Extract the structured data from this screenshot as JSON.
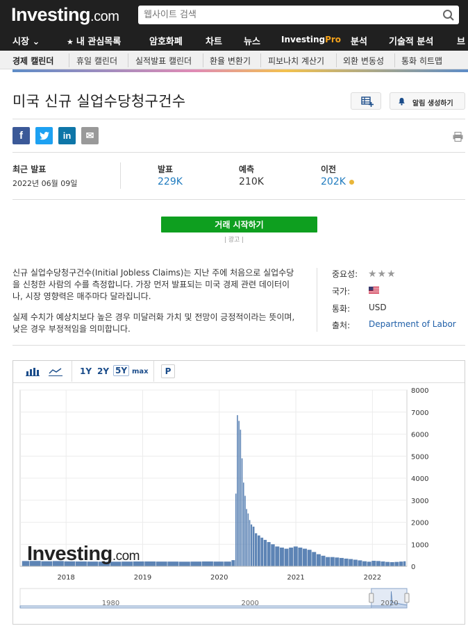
{
  "header": {
    "logo_main": "Investing",
    "logo_domain": ".com",
    "search_placeholder": "웹사이트 검색"
  },
  "nav": {
    "items": [
      {
        "label": "시장 ⌄"
      },
      {
        "label": "내 관심목록"
      },
      {
        "label": "암호화폐"
      },
      {
        "label": "차트"
      },
      {
        "label": "뉴스"
      },
      {
        "label": "Investing",
        "pro": "Pro"
      },
      {
        "label": "분석"
      },
      {
        "label": "기술적 분석"
      },
      {
        "label": "브"
      }
    ]
  },
  "subnav": {
    "items": [
      "경제 캘린더",
      "휴일 캘린더",
      "실적발표 캘린더",
      "환율 변환기",
      "피보나치 계산기",
      "외환 변동성",
      "통화 히트맵"
    ]
  },
  "page": {
    "title": "미국 신규 실업수당청구건수",
    "alert_button": "알림 생성하기"
  },
  "social": {
    "facebook": "f",
    "twitter": "t",
    "linkedin": "in",
    "email": "✉"
  },
  "release": {
    "latest_label": "최근 발표",
    "latest_date": "2022년 06월 09일",
    "actual_label": "발표",
    "actual_value": "229K",
    "forecast_label": "예측",
    "forecast_value": "210K",
    "previous_label": "이전",
    "previous_value": "202K",
    "previous_dot_color": "#e9b63a"
  },
  "trade": {
    "button": "거래 시작하기",
    "ad_label": "| 광고 |"
  },
  "description": {
    "p1": "신규 실업수당청구건수(Initial Jobless Claims)는 지난 주에 처음으로 실업수당을 신청한 사람의 수를 측정합니다. 가장 먼저 발표되는 미국 경제 관련 데이터이나, 시장 영향력은 매주마다 달라집니다.",
    "p2": "실제 수치가 예상치보다 높은 경우 미달러화 가치 및 전망이 긍정적이라는 뜻이며, 낮은 경우 부정적임을 의미합니다."
  },
  "details": {
    "importance_label": "중요성:",
    "importance_stars": 3,
    "country_label": "국가:",
    "country_flag": "us-flag-icon",
    "currency_label": "통화:",
    "currency_value": "USD",
    "source_label": "출처:",
    "source_value": "Department of Labor"
  },
  "chart_toolbar": {
    "ranges": [
      "1Y",
      "2Y",
      "5Y",
      "max"
    ],
    "selected_range": "5Y",
    "p_label": "P"
  },
  "chart_data": {
    "type": "bar",
    "bar_color": "#5d84b5",
    "ylim": [
      0,
      8000
    ],
    "yticks": [
      0,
      1000,
      2000,
      3000,
      4000,
      5000,
      6000,
      7000,
      8000
    ],
    "ytick_labels": [
      "0",
      "1000",
      "2000",
      "3000",
      "4000",
      "5000",
      "6000",
      "7000",
      "8000"
    ],
    "xticks": [
      2018,
      2019,
      2020,
      2021,
      2022
    ],
    "x_range": [
      2017.4,
      2022.45
    ],
    "series": [
      {
        "values_note_excluded": false,
        "points": [
          [
            2017.45,
            240
          ],
          [
            2017.6,
            245
          ],
          [
            2017.75,
            230
          ],
          [
            2017.9,
            240
          ],
          [
            2018.05,
            225
          ],
          [
            2018.2,
            220
          ],
          [
            2018.35,
            215
          ],
          [
            2018.5,
            210
          ],
          [
            2018.65,
            210
          ],
          [
            2018.8,
            215
          ],
          [
            2018.95,
            220
          ],
          [
            2019.1,
            220
          ],
          [
            2019.25,
            215
          ],
          [
            2019.4,
            215
          ],
          [
            2019.55,
            210
          ],
          [
            2019.7,
            215
          ],
          [
            2019.85,
            220
          ],
          [
            2020.0,
            215
          ],
          [
            2020.12,
            215
          ],
          [
            2020.2,
            280
          ],
          [
            2020.22,
            3300
          ],
          [
            2020.24,
            6860
          ],
          [
            2020.26,
            6600
          ],
          [
            2020.28,
            6200
          ],
          [
            2020.3,
            4900
          ],
          [
            2020.32,
            3800
          ],
          [
            2020.34,
            3200
          ],
          [
            2020.36,
            2600
          ],
          [
            2020.38,
            2400
          ],
          [
            2020.4,
            2100
          ],
          [
            2020.42,
            1900
          ],
          [
            2020.45,
            1800
          ],
          [
            2020.48,
            1500
          ],
          [
            2020.52,
            1400
          ],
          [
            2020.56,
            1300
          ],
          [
            2020.6,
            1200
          ],
          [
            2020.65,
            1100
          ],
          [
            2020.7,
            1000
          ],
          [
            2020.76,
            900
          ],
          [
            2020.82,
            850
          ],
          [
            2020.88,
            800
          ],
          [
            2020.94,
            850
          ],
          [
            2021.0,
            900
          ],
          [
            2021.06,
            850
          ],
          [
            2021.12,
            800
          ],
          [
            2021.18,
            750
          ],
          [
            2021.24,
            650
          ],
          [
            2021.3,
            550
          ],
          [
            2021.36,
            480
          ],
          [
            2021.42,
            420
          ],
          [
            2021.48,
            420
          ],
          [
            2021.54,
            400
          ],
          [
            2021.6,
            380
          ],
          [
            2021.66,
            350
          ],
          [
            2021.72,
            330
          ],
          [
            2021.78,
            300
          ],
          [
            2021.84,
            270
          ],
          [
            2021.9,
            230
          ],
          [
            2021.96,
            210
          ],
          [
            2022.02,
            250
          ],
          [
            2022.08,
            240
          ],
          [
            2022.14,
            220
          ],
          [
            2022.2,
            200
          ],
          [
            2022.26,
            190
          ],
          [
            2022.32,
            200
          ],
          [
            2022.38,
            215
          ],
          [
            2022.43,
            229
          ]
        ]
      }
    ],
    "navigator": {
      "xticks": [
        1980,
        2000,
        2020
      ],
      "range": [
        1967,
        2022.5
      ]
    }
  },
  "chart_watermark": {
    "main": "Investing",
    "domain": ".com"
  }
}
